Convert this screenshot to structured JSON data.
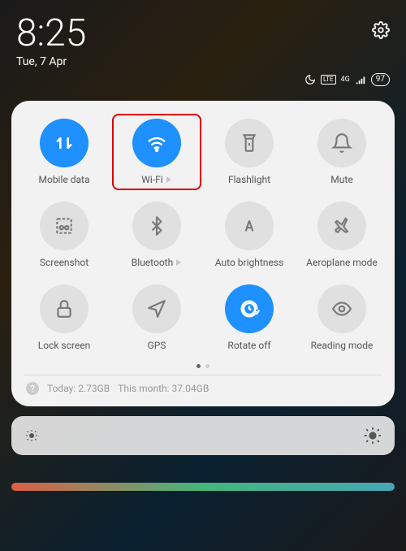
{
  "status": {
    "time": "8:25",
    "date": "Tue, 7 Apr",
    "battery": "97"
  },
  "tiles": [
    {
      "id": "mobile-data",
      "label": "Mobile data",
      "active": true,
      "expandable": false
    },
    {
      "id": "wifi",
      "label": "Wi-Fi",
      "active": true,
      "expandable": true
    },
    {
      "id": "flashlight",
      "label": "Flashlight",
      "active": false,
      "expandable": false
    },
    {
      "id": "mute",
      "label": "Mute",
      "active": false,
      "expandable": false
    },
    {
      "id": "screenshot",
      "label": "Screenshot",
      "active": false,
      "expandable": false
    },
    {
      "id": "bluetooth",
      "label": "Bluetooth",
      "active": false,
      "expandable": true
    },
    {
      "id": "auto-brightness",
      "label": "Auto brightness",
      "active": false,
      "expandable": false
    },
    {
      "id": "aeroplane",
      "label": "Aeroplane mode",
      "active": false,
      "expandable": false
    },
    {
      "id": "lock-screen",
      "label": "Lock screen",
      "active": false,
      "expandable": false
    },
    {
      "id": "gps",
      "label": "GPS",
      "active": false,
      "expandable": false
    },
    {
      "id": "rotate-off",
      "label": "Rotate off",
      "active": true,
      "expandable": false
    },
    {
      "id": "reading-mode",
      "label": "Reading mode",
      "active": false,
      "expandable": false
    }
  ],
  "usage": {
    "today_label": "Today:",
    "today_value": "2.73GB",
    "month_label": "This month:",
    "month_value": "37.04GB"
  },
  "highlighted_tile": "wifi"
}
